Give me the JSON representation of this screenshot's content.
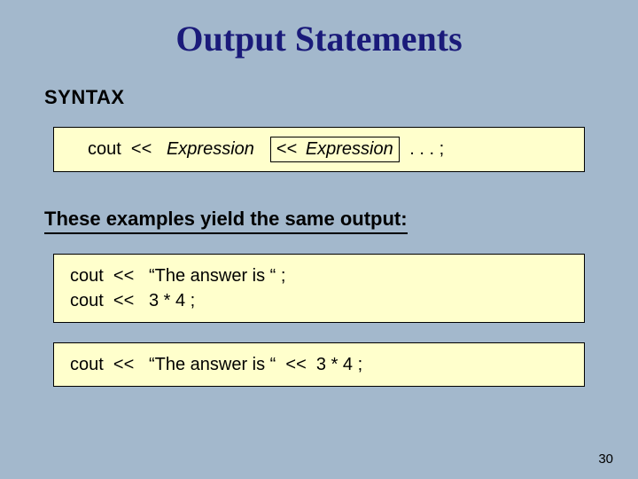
{
  "title": "Output Statements",
  "sections": {
    "syntax": {
      "label": "SYNTAX",
      "lead": "cout  <<   ",
      "lead_italic": "Expression",
      "optional_op": "<< ",
      "optional_italic": "Expression",
      "tail": " . . . ;"
    },
    "examples": {
      "heading": "These examples yield the same output:",
      "box1": {
        "line1": "cout  <<   “The answer is “ ;",
        "line2": "cout  <<   3 * 4 ;"
      },
      "box2": {
        "line1": "cout  <<   “The answer is “  <<  3 * 4 ;"
      }
    }
  },
  "page_number": "30"
}
